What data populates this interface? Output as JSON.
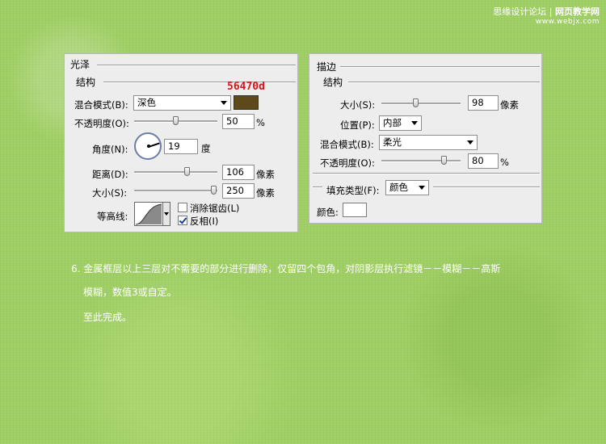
{
  "watermark": {
    "site_a": "思缘设计论坛",
    "site_b": "网页教学网",
    "url": "www.webjx.com"
  },
  "gloss_panel": {
    "title": "光泽",
    "section": "结构",
    "blend_mode_label": "混合模式(B):",
    "blend_mode_value": "深色",
    "color_swatch": "#5c4a1a",
    "color_code_note": "56470d",
    "color_code_note_color": "#d8141c",
    "opacity_label": "不透明度(O):",
    "opacity_value": "50",
    "opacity_unit": "%",
    "angle_label": "角度(N):",
    "angle_value": "19",
    "angle_unit": "度",
    "distance_label": "距离(D):",
    "distance_value": "106",
    "distance_unit": "像素",
    "size_label": "大小(S):",
    "size_value": "250",
    "size_unit": "像素",
    "contour_label": "等高线:",
    "antialias_label": "消除锯齿(L)",
    "antialias_checked": false,
    "invert_label": "反相(I)",
    "invert_checked": true
  },
  "stroke_panel": {
    "title": "描边",
    "section": "结构",
    "size_label": "大小(S):",
    "size_value": "98",
    "size_unit": "像素",
    "position_label": "位置(P):",
    "position_value": "内部",
    "blend_mode_label": "混合模式(B):",
    "blend_mode_value": "柔光",
    "opacity_label": "不透明度(O):",
    "opacity_value": "80",
    "opacity_unit": "%",
    "fill_type_label": "填充类型(F):",
    "fill_type_value": "颜色",
    "color_label": "颜色:",
    "color_value": "#ffffff"
  },
  "instructions": {
    "line1": "6. 金属框层以上三层对不需要的部分进行删除，仅留四个包角，对阴影层执行滤镜－－模糊－－高斯",
    "line2": "模糊，数值3或自定。",
    "line3": "至此完成。"
  }
}
